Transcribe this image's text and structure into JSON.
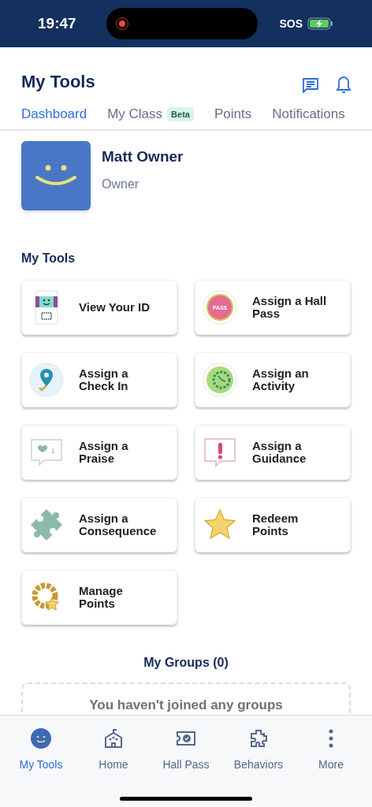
{
  "status_bar": {
    "time": "19:47",
    "network": "SOS"
  },
  "header": {
    "title": "My Tools"
  },
  "tabs": [
    {
      "label": "Dashboard",
      "selected": true
    },
    {
      "label": "My Class",
      "badge": "Beta",
      "selected": false
    },
    {
      "label": "Points",
      "selected": false
    },
    {
      "label": "Notifications",
      "selected": false
    }
  ],
  "profile": {
    "name": "Matt Owner",
    "role": "Owner"
  },
  "tools_section": {
    "title": "My Tools"
  },
  "tools": [
    {
      "kind": "id",
      "label": "View Your ID"
    },
    {
      "kind": "pass",
      "label": "Assign a Hall Pass",
      "icon_text": "PASS"
    },
    {
      "kind": "checkin",
      "label": "Assign a Check In"
    },
    {
      "kind": "activity",
      "label": "Assign an Activity"
    },
    {
      "kind": "praise",
      "label": "Assign a Praise",
      "icon_text": "1"
    },
    {
      "kind": "guidance",
      "label": "Assign a Guidance"
    },
    {
      "kind": "consequence",
      "label": "Assign a Consequence"
    },
    {
      "kind": "star",
      "label": "Redeem Points"
    },
    {
      "kind": "manage",
      "label": "Manage Points"
    }
  ],
  "groups": {
    "title": "My Groups (0)",
    "empty_message": "You haven't joined any groups"
  },
  "bottom_nav": [
    {
      "kind": "tools",
      "label": "My Tools",
      "selected": true
    },
    {
      "kind": "home",
      "label": "Home",
      "selected": false
    },
    {
      "kind": "pass",
      "label": "Hall Pass",
      "selected": false
    },
    {
      "kind": "behaviors",
      "label": "Behaviors",
      "selected": false
    },
    {
      "kind": "more",
      "label": "More",
      "selected": false
    }
  ]
}
